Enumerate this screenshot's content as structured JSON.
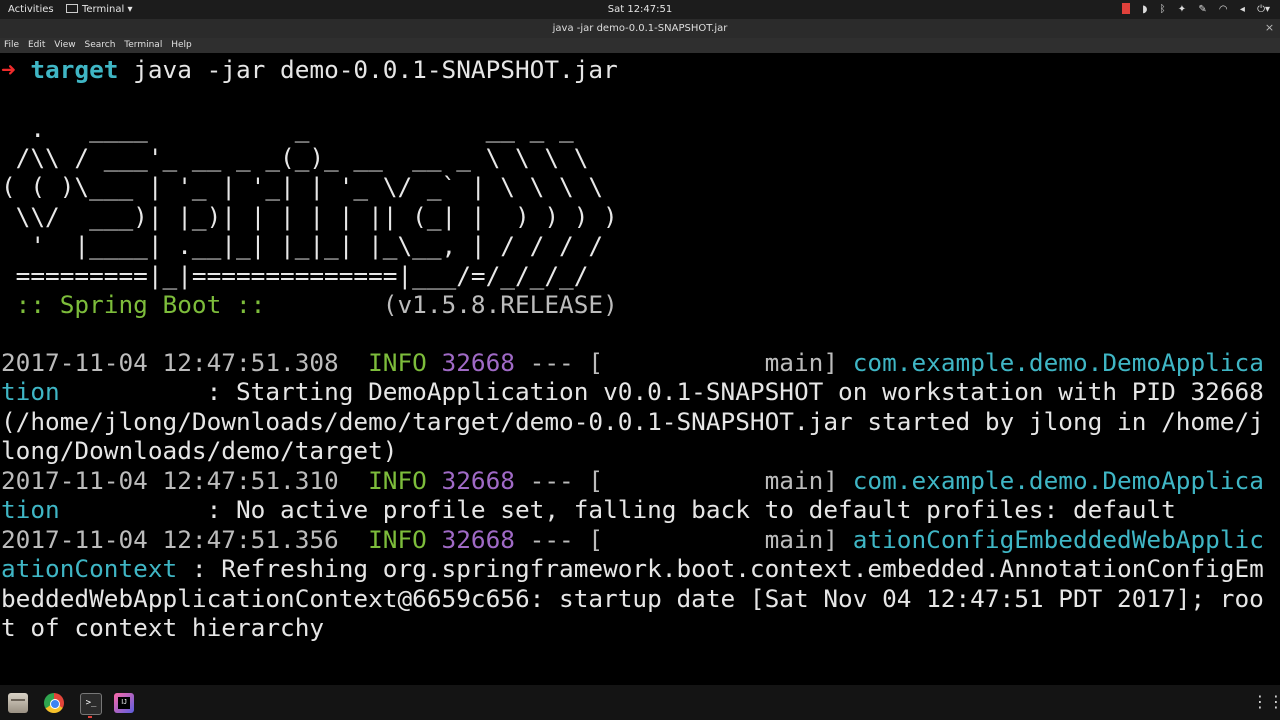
{
  "topbar": {
    "activities": "Activities",
    "app_menu": "Terminal",
    "app_menu_arrow": "▾",
    "clock": "Sat 12:47:51",
    "tray_icons": [
      "record-icon",
      "chrome-tray-icon",
      "bluetooth-icon",
      "dropbox-icon",
      "pen-icon",
      "wifi-icon",
      "volume-icon",
      "power-icon"
    ],
    "tray_glyphs": [
      "",
      "◗",
      "ᛒ",
      "✦",
      "✎",
      "◠",
      "◂",
      "⏻▾"
    ]
  },
  "window": {
    "title": "java -jar demo-0.0.1-SNAPSHOT.jar",
    "close": "×"
  },
  "menubar": [
    "File",
    "Edit",
    "View",
    "Search",
    "Terminal",
    "Help"
  ],
  "terminal": {
    "prompt_arrow": "➜",
    "prompt_dir": "target",
    "command": " java -jar demo-0.0.1-SNAPSHOT.jar",
    "banner": [
      "  .   ____          _            __ _ _",
      " /\\\\ / ___'_ __ _ _(_)_ __  __ _ \\ \\ \\ \\",
      "( ( )\\___ | '_ | '_| | '_ \\/ _` | \\ \\ \\ \\",
      " \\\\/  ___)| |_)| | | | | || (_| |  ) ) ) )",
      "  '  |____| .__|_| |_|_| |_\\__, | / / / /",
      " =========|_|==============|___/=/_/_/_/"
    ],
    "boot_label": " :: Spring Boot :: ",
    "boot_version": "       (v1.5.8.RELEASE)",
    "logs": [
      {
        "ts": "2017-11-04 12:47:51.308",
        "level": "  INFO",
        "pid": " 32668",
        "dash": " --- [",
        "thread": "           main] ",
        "logger": "com.example.demo.DemoApplica",
        "cont": [
          {
            "logger": "tion",
            "msg": "          : Starting DemoApplication v0.0.1-SNAPSHOT on workstation with PID 32668"
          },
          {
            "logger": "",
            "msg": "(/home/jlong/Downloads/demo/target/demo-0.0.1-SNAPSHOT.jar started by jlong in /home/j"
          },
          {
            "logger": "",
            "msg": "long/Downloads/demo/target)"
          }
        ]
      },
      {
        "ts": "2017-11-04 12:47:51.310",
        "level": "  INFO",
        "pid": " 32668",
        "dash": " --- [",
        "thread": "           main] ",
        "logger": "com.example.demo.DemoApplica",
        "cont": [
          {
            "logger": "tion",
            "msg": "          : No active profile set, falling back to default profiles: default"
          }
        ]
      },
      {
        "ts": "2017-11-04 12:47:51.356",
        "level": "  INFO",
        "pid": " 32668",
        "dash": " --- [",
        "thread": "           main] ",
        "logger": "ationConfigEmbeddedWebApplic",
        "cont": [
          {
            "logger": "ationContext",
            "msg": " : Refreshing org.springframework.boot.context.embedded.AnnotationConfigEm"
          },
          {
            "logger": "",
            "msg": "beddedWebApplicationContext@6659c656: startup date [Sat Nov 04 12:47:51 PDT 2017]; roo"
          },
          {
            "logger": "",
            "msg": "t of context hierarchy"
          }
        ]
      }
    ]
  },
  "dock": {
    "items": [
      "files-icon",
      "chrome-icon",
      "terminal-icon",
      "intellij-icon"
    ],
    "terminal_glyph": ">_",
    "apps_glyph": "⋮⋮⋮"
  }
}
